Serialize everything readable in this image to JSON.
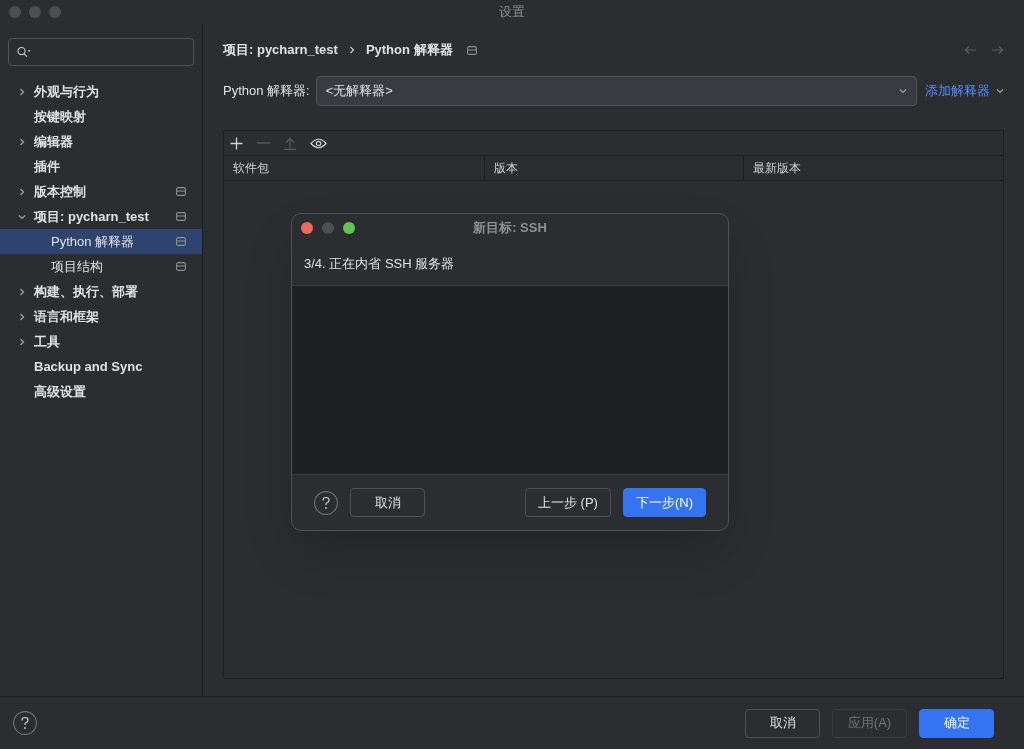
{
  "window": {
    "title": "设置"
  },
  "sidebar": {
    "items": [
      {
        "label": "外观与行为",
        "kind": "group",
        "expanded": false,
        "selected": false,
        "scoped": false
      },
      {
        "label": "按键映射",
        "kind": "page",
        "selected": false,
        "scoped": false
      },
      {
        "label": "编辑器",
        "kind": "group",
        "expanded": false,
        "selected": false,
        "scoped": false
      },
      {
        "label": "插件",
        "kind": "page",
        "selected": false,
        "scoped": false
      },
      {
        "label": "版本控制",
        "kind": "group",
        "expanded": false,
        "selected": false,
        "scoped": true
      },
      {
        "label": "项目: pycharn_test",
        "kind": "group",
        "expanded": true,
        "selected": false,
        "scoped": true,
        "children": [
          {
            "label": "Python 解释器",
            "kind": "page",
            "selected": true,
            "scoped": true
          },
          {
            "label": "项目结构",
            "kind": "page",
            "selected": false,
            "scoped": true
          }
        ]
      },
      {
        "label": "构建、执行、部署",
        "kind": "group",
        "expanded": false,
        "selected": false,
        "scoped": false
      },
      {
        "label": "语言和框架",
        "kind": "group",
        "expanded": false,
        "selected": false,
        "scoped": false
      },
      {
        "label": "工具",
        "kind": "group",
        "expanded": false,
        "selected": false,
        "scoped": false
      },
      {
        "label": "Backup and Sync",
        "kind": "page",
        "selected": false,
        "scoped": false
      },
      {
        "label": "高级设置",
        "kind": "page",
        "selected": false,
        "scoped": false
      }
    ]
  },
  "breadcrumb": [
    "项目: pycharn_test",
    "Python 解释器"
  ],
  "interpreter": {
    "label": "Python 解释器:",
    "value": "<无解释器>",
    "add_link": "添加解释器"
  },
  "packages_table": {
    "columns": [
      "软件包",
      "版本",
      "最新版本"
    ]
  },
  "dialog": {
    "title": "新目标: SSH",
    "step": "3/4. 正在内省 SSH 服务器",
    "buttons": [
      {
        "label": "取消",
        "kind": "secondary"
      },
      {
        "label": "上一步 (P)",
        "kind": "secondary"
      },
      {
        "label": "下一步(N)",
        "kind": "primary"
      }
    ]
  },
  "footer_buttons": [
    {
      "label": "取消",
      "kind": "secondary",
      "disabled": false
    },
    {
      "label": "应用(A)",
      "kind": "secondary",
      "disabled": true
    },
    {
      "label": "确定",
      "kind": "primary",
      "disabled": false
    }
  ]
}
